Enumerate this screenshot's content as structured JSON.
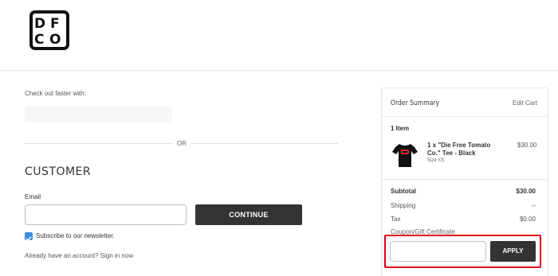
{
  "logo": {
    "letters": [
      "D",
      "F",
      "C",
      "O"
    ]
  },
  "wallet": {
    "prompt": "Check out faster with:"
  },
  "divider": {
    "or": "OR"
  },
  "customer": {
    "heading": "CUSTOMER",
    "email_label": "Email",
    "email_value": "",
    "continue_label": "CONTINUE",
    "subscribe_label": "Subscribe to our newsletter.",
    "subscribe_checked": true,
    "signin_text": "Already have an account? Sign in now"
  },
  "summary": {
    "title": "Order Summary",
    "edit_cart": "Edit Cart",
    "item_count": "1 Item",
    "item": {
      "name": "1 x \"Die Free Tomato Co.\" Tee - Black",
      "size": "Size XS",
      "price": "$30.00",
      "image_icon": "black-tshirt-icon"
    },
    "subtotal_label": "Subtotal",
    "subtotal_value": "$30.00",
    "shipping_label": "Shipping",
    "shipping_value": "--",
    "tax_label": "Tax",
    "tax_value": "$0.00",
    "coupon_label": "Coupon/Gift Certificate",
    "coupon_value": "",
    "apply_label": "APPLY"
  },
  "colors": {
    "button_dark": "#333333",
    "checkbox_blue": "#3c8de0",
    "highlight_red": "#e0001b"
  }
}
